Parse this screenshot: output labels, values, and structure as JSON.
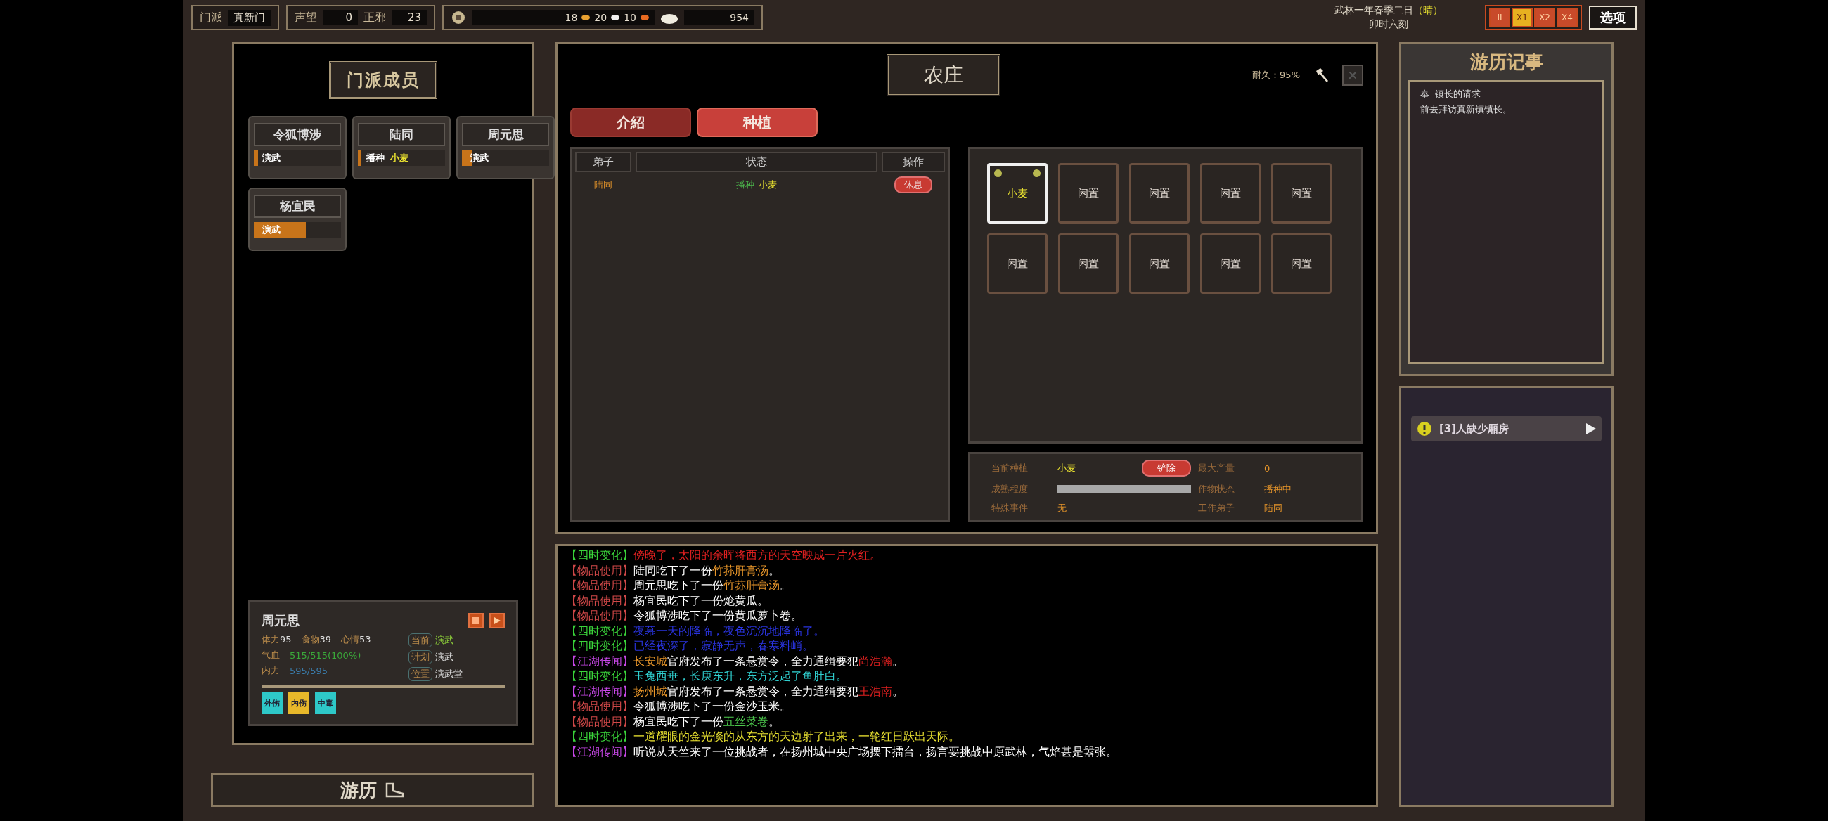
{
  "top_bar": {
    "sect_label": "门派",
    "sect_name": "真新门",
    "stats": [
      {
        "label": "声望",
        "value": "0"
      },
      {
        "label": "正邪",
        "value": "23"
      }
    ],
    "resources": [
      "18",
      "20",
      "10"
    ],
    "money": "954",
    "date": "武林一年春季二日",
    "weather": "（晴）",
    "time": "卯时六刻",
    "speeds": [
      {
        "label": "II",
        "selected": false
      },
      {
        "label": "X1",
        "selected": true
      },
      {
        "label": "X2",
        "selected": false
      },
      {
        "label": "X4",
        "selected": false
      }
    ],
    "options": "选项"
  },
  "members_panel": {
    "title": "门派成员",
    "members": [
      {
        "name": "令狐博涉",
        "status": [
          {
            "text": "演武",
            "color": "#ffffff"
          }
        ],
        "level": 0.05
      },
      {
        "name": "陆同",
        "status": [
          {
            "text": "播种",
            "color": "#ffffff"
          },
          {
            "text": "小麦",
            "color": "#e8e030"
          }
        ],
        "level": 0.03
      },
      {
        "name": "周元思",
        "status": [
          {
            "text": "演武",
            "color": "#ffffff"
          }
        ],
        "level": 0.12
      },
      {
        "name": "杨宜民",
        "status": [
          {
            "text": "演武",
            "color": "#ffffff"
          }
        ],
        "level": 0.6
      }
    ]
  },
  "member_detail": {
    "name": "周元思",
    "stats": [
      {
        "label": "体力",
        "value": "95"
      },
      {
        "label": "食物",
        "value": "39"
      },
      {
        "label": "心情",
        "value": "53"
      }
    ],
    "bars": [
      {
        "label": "气血",
        "value": "515/515(100%)",
        "color": "#3aa83a"
      },
      {
        "label": "内力",
        "value": "595/595",
        "color": "#3a7aa8"
      }
    ],
    "tags": [
      {
        "label": "当前",
        "value": "演武",
        "color": "#8ed03a"
      },
      {
        "label": "计划",
        "value": "演武"
      },
      {
        "label": "位置",
        "value": "演武堂"
      }
    ],
    "effects": [
      {
        "text": "外伤",
        "color": "#2ec8c8"
      },
      {
        "text": "内伤",
        "color": "#e8b82a"
      },
      {
        "text": "中毒",
        "color": "#2ec8c8"
      }
    ]
  },
  "travel_button": "游历",
  "building": {
    "title": "农庄",
    "durability": "耐久：95%",
    "tabs": [
      {
        "label": "介紹",
        "selected": false
      },
      {
        "label": "种植",
        "selected": true
      }
    ],
    "table": {
      "columns": [
        "弟子",
        "状态",
        "操作"
      ],
      "rows": [
        {
          "disciple": "陆同",
          "status": [
            {
              "text": "播种",
              "color": "#4cb84c"
            },
            {
              "text": "小麦",
              "color": "#e8e030"
            }
          ],
          "action": "休息"
        }
      ]
    },
    "plots": [
      {
        "label": "小麦",
        "selected": true,
        "planted": true
      },
      {
        "label": "闲置",
        "selected": false,
        "planted": false
      },
      {
        "label": "闲置",
        "selected": false,
        "planted": false
      },
      {
        "label": "闲置",
        "selected": false,
        "planted": false
      },
      {
        "label": "闲置",
        "selected": false,
        "planted": false
      },
      {
        "label": "闲置",
        "selected": false,
        "planted": false
      },
      {
        "label": "闲置",
        "selected": false,
        "planted": false
      },
      {
        "label": "闲置",
        "selected": false,
        "planted": false
      },
      {
        "label": "闲置",
        "selected": false,
        "planted": false
      },
      {
        "label": "闲置",
        "selected": false,
        "planted": false
      }
    ],
    "info": {
      "crop_label": "当前种植",
      "crop": "小麦",
      "remove": "铲除",
      "max_yield_label": "最大产量",
      "max_yield": "0",
      "maturity_label": "成熟程度",
      "crop_state_label": "作物状态",
      "crop_state": "播种中",
      "event_label": "特殊事件",
      "event": "无",
      "worker_label": "工作弟子",
      "worker": "陆同"
    }
  },
  "log": [
    {
      "tag": {
        "text": "【四时变化】",
        "color": "#3ad43a"
      },
      "segments": [
        {
          "text": "傍晚了，太阳的余晖将西方的天空映成一片火红。",
          "color": "#e02020"
        }
      ]
    },
    {
      "tag": {
        "text": "【物品使用】",
        "color": "#d04848"
      },
      "segments": [
        {
          "text": "陆同吃下了一份"
        },
        {
          "text": "竹荪肝膏汤",
          "color": "#e8962a"
        },
        {
          "text": "。"
        }
      ]
    },
    {
      "tag": {
        "text": "【物品使用】",
        "color": "#d04848"
      },
      "segments": [
        {
          "text": "周元思吃下了一份"
        },
        {
          "text": "竹荪肝膏汤",
          "color": "#e8962a"
        },
        {
          "text": "。"
        }
      ]
    },
    {
      "tag": {
        "text": "【物品使用】",
        "color": "#d04848"
      },
      "segments": [
        {
          "text": "杨宜民吃下了一份炝黄瓜。"
        }
      ]
    },
    {
      "tag": {
        "text": "【物品使用】",
        "color": "#d04848"
      },
      "segments": [
        {
          "text": "令狐博涉吃下了一份黄瓜萝卜卷。"
        }
      ]
    },
    {
      "tag": {
        "text": "【四时变化】",
        "color": "#3ad43a"
      },
      "segments": [
        {
          "text": "夜幕一天的降临，夜色沉沉地降临了。",
          "color": "#2a34e0"
        }
      ]
    },
    {
      "tag": {
        "text": "【四时变化】",
        "color": "#3ad43a"
      },
      "segments": [
        {
          "text": "已经夜深了，寂静无声，春寒料峭。",
          "color": "#2a34e0"
        }
      ]
    },
    {
      "tag": {
        "text": "【江湖传闻】",
        "color": "#c848e8"
      },
      "segments": [
        {
          "text": "长安城",
          "color": "#e8962a"
        },
        {
          "text": "官府发布了一条悬赏令，全力通缉要犯"
        },
        {
          "text": "尚浩瀚",
          "color": "#e02020"
        },
        {
          "text": "。"
        }
      ]
    },
    {
      "tag": {
        "text": "【四时变化】",
        "color": "#3ad43a"
      },
      "segments": [
        {
          "text": "玉兔西垂，长庚东升，东方泛起了鱼肚白。",
          "color": "#30d0d0"
        }
      ]
    },
    {
      "tag": {
        "text": "【江湖传闻】",
        "color": "#c848e8"
      },
      "segments": [
        {
          "text": "扬州城",
          "color": "#e8962a"
        },
        {
          "text": "官府发布了一条悬赏令，全力通缉要犯"
        },
        {
          "text": "王浩南",
          "color": "#e02020"
        },
        {
          "text": "。"
        }
      ]
    },
    {
      "tag": {
        "text": "【物品使用】",
        "color": "#d04848"
      },
      "segments": [
        {
          "text": "令狐博涉吃下了一份金沙玉米。"
        }
      ]
    },
    {
      "tag": {
        "text": "【物品使用】",
        "color": "#d04848"
      },
      "segments": [
        {
          "text": "杨宜民吃下了一份"
        },
        {
          "text": "五丝菜卷",
          "color": "#4cc84c"
        },
        {
          "text": "。"
        }
      ]
    },
    {
      "tag": {
        "text": "【四时变化】",
        "color": "#3ad43a"
      },
      "segments": [
        {
          "text": "一道耀眼的金光倏的从东方的天边射了出来，一轮红日跃出天际。",
          "color": "#e8e030"
        }
      ]
    },
    {
      "tag": {
        "text": "【江湖传闻】",
        "color": "#c848e8"
      },
      "segments": [
        {
          "text": "听说从天竺来了一位挑战者，在扬州城中央广场摆下擂台，扬言要挑战中原武林，气焰甚是嚣张。"
        }
      ]
    }
  ],
  "journal": {
    "title": "游历记事",
    "entries": [
      {
        "marker": "奉",
        "title": "镇长的请求",
        "text": "前去拜访真新镇镇长。"
      }
    ]
  },
  "quests": [
    {
      "text": "[3]人缺少厢房"
    }
  ]
}
